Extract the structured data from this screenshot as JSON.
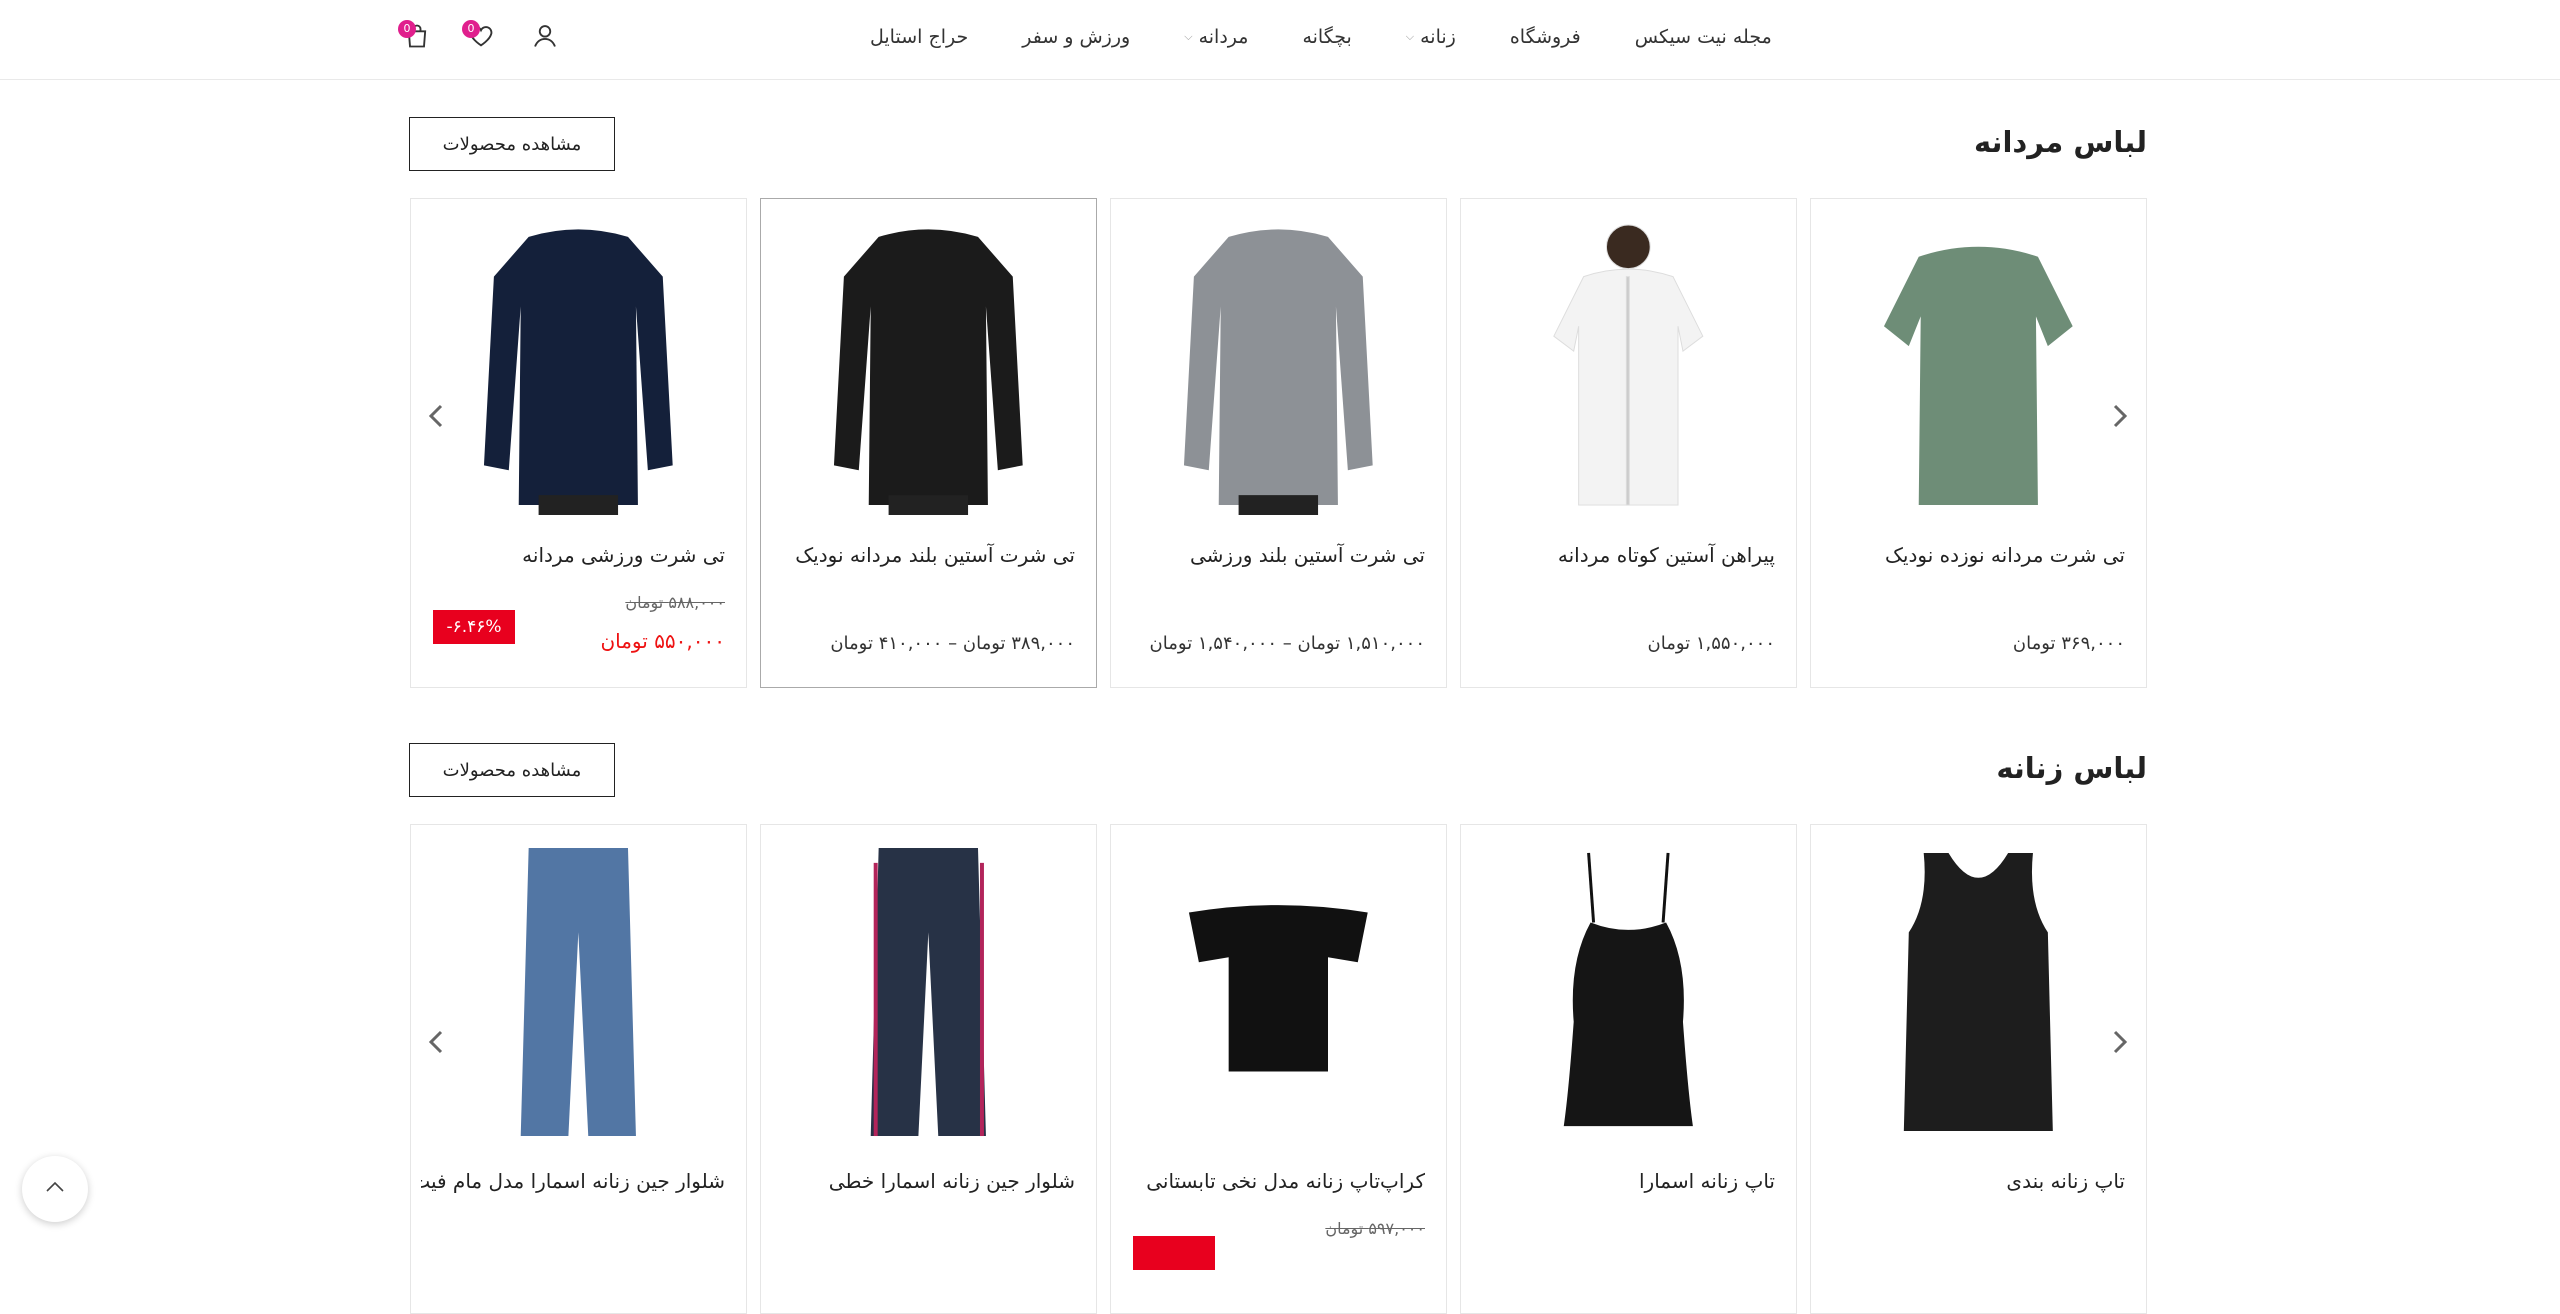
{
  "header": {
    "nav": [
      {
        "label": "حراج استایل",
        "has_dropdown": false
      },
      {
        "label": "ورزش و سفر",
        "has_dropdown": false
      },
      {
        "label": "مردانه",
        "has_dropdown": true
      },
      {
        "label": "بچگانه",
        "has_dropdown": false
      },
      {
        "label": "زنانه",
        "has_dropdown": true
      },
      {
        "label": "فروشگاه",
        "has_dropdown": false
      },
      {
        "label": "مجله نیت سیکس",
        "has_dropdown": false
      }
    ],
    "wishlist_count": "0",
    "cart_count": "0",
    "icons": [
      "user-icon",
      "heart-icon",
      "shopping-bag-icon"
    ]
  },
  "sections": [
    {
      "title": "لباس مردانه",
      "view_button": "مشاهده محصولات",
      "products": [
        {
          "name": "تی شرت مردانه نوزده نودیک",
          "price": "۳۶۹,۰۰۰ تومان",
          "image": "green-tshirt"
        },
        {
          "name": "پیراهن آستین کوتاه مردانه",
          "price": "۱,۵۵۰,۰۰۰ تومان",
          "image": "white-shirt"
        },
        {
          "name": "تی شرت آستین بلند ورزشی",
          "price": "۱,۵۱۰,۰۰۰ تومان – ۱,۵۴۰,۰۰۰ تومان",
          "image": "grey-longsleeve"
        },
        {
          "name": "تی شرت آستین بلند مردانه نودیک",
          "price": "۳۸۹,۰۰۰ تومان – ۴۱۰,۰۰۰ تومان",
          "image": "black-longsleeve"
        },
        {
          "name": "تی شرت ورزشی مردانه",
          "old_price": "۵۸۸,۰۰۰ تومان",
          "sale_price": "۵۵۰,۰۰۰ تومان",
          "discount": "-۶.۴۶%",
          "image": "navy-longsleeve"
        }
      ]
    },
    {
      "title": "لباس زنانه",
      "view_button": "مشاهده محصولات",
      "products": [
        {
          "name": "تاپ زنانه بندی",
          "image": "black-tank"
        },
        {
          "name": "تاپ زنانه اسمارا",
          "image": "black-cami"
        },
        {
          "name": "کراپ‌تاپ زنانه مدل نخی تابستانی",
          "old_price": "۵۹۷,۰۰۰ تومان",
          "image": "black-crop"
        },
        {
          "name": "شلوار جین زنانه اسمارا خطی",
          "image": "dark-jeans-stripe"
        },
        {
          "name": "شلوار جین زنانه اسمارا مدل مام فیت",
          "image": "blue-jeans"
        }
      ]
    }
  ],
  "colors": {
    "accent_badge": "#e01f8d",
    "discount": "#e8001e",
    "sale_price": "#e11111"
  }
}
